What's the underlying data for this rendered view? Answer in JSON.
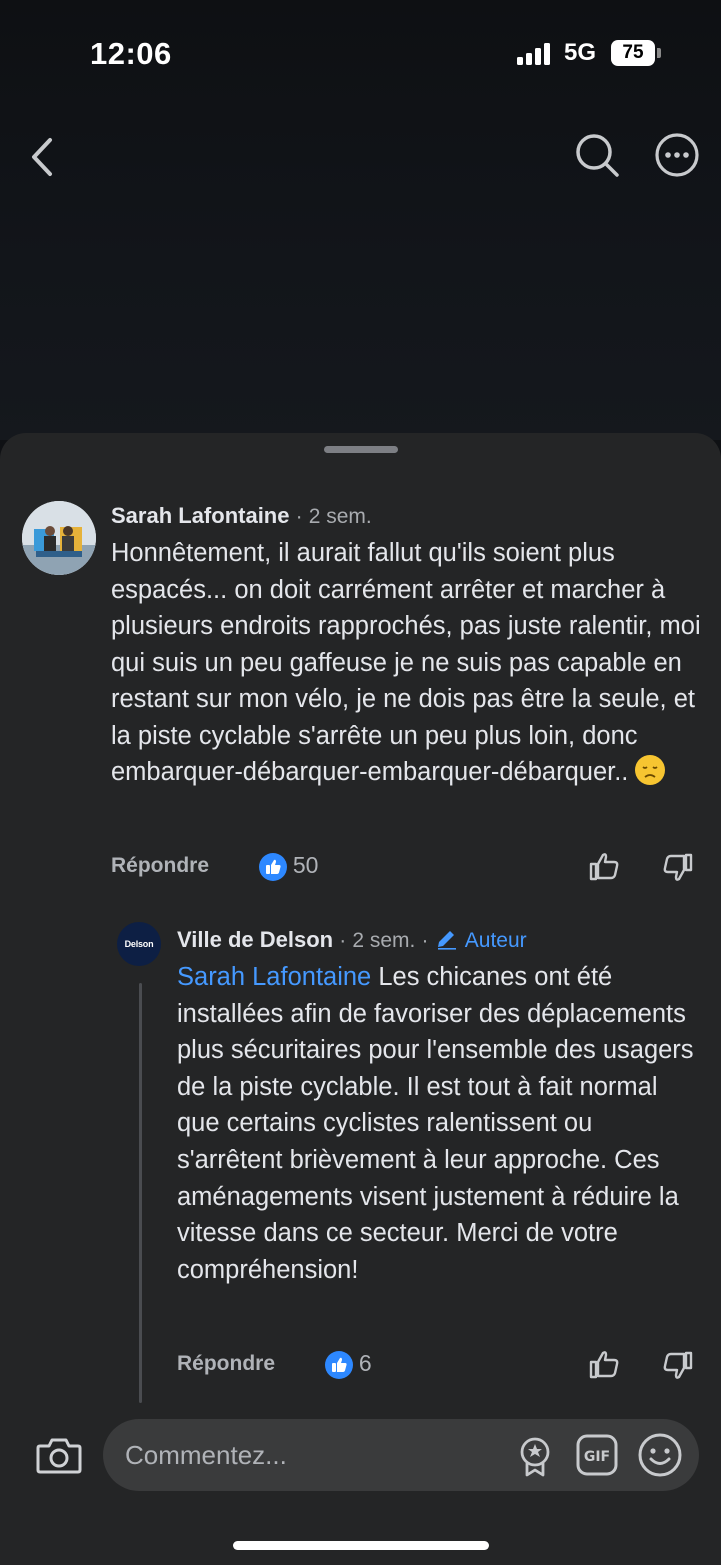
{
  "status": {
    "time": "12:06",
    "network": "5G",
    "battery": "75"
  },
  "comment": {
    "author": "Sarah Lafontaine",
    "separator": "·",
    "age": "2 sem.",
    "text": "Honnêtement, il aurait fallut qu'ils soient plus espacés... on doit carrément arrêter et marcher à plusieurs endroits rapprochés, pas juste ralentir, moi qui suis un peu gaffeuse je ne suis pas capable en restant sur mon vélo, je ne dois pas être la seule, et la piste cyclable s'arrête un peu plus loin, donc embarquer-débarquer-embarquer-débarquer..",
    "reply_label": "Répondre",
    "like_count": "50"
  },
  "reply": {
    "avatar_text": "Delson",
    "author": "Ville de Delson",
    "separator": "·",
    "age": "2 sem.",
    "separator2": "·",
    "author_tag": "Auteur",
    "mention": "Sarah Lafontaine",
    "text": " Les chicanes ont été installées afin de favoriser des déplacements plus sécuritaires pour l'ensemble des usagers de la piste cyclable. Il est tout à fait normal que certains cyclistes ralentissent ou s'arrêtent brièvement à leur approche. Ces aménagements visent justement à réduire la vitesse dans ce secteur. Merci de votre compréhension!",
    "reply_label": "Répondre",
    "like_count": "6"
  },
  "composer": {
    "placeholder": "Commentez..."
  },
  "colors": {
    "sheet": "#242526",
    "accent": "#2d88ff",
    "link": "#4599ff",
    "input": "#3a3b3c"
  }
}
